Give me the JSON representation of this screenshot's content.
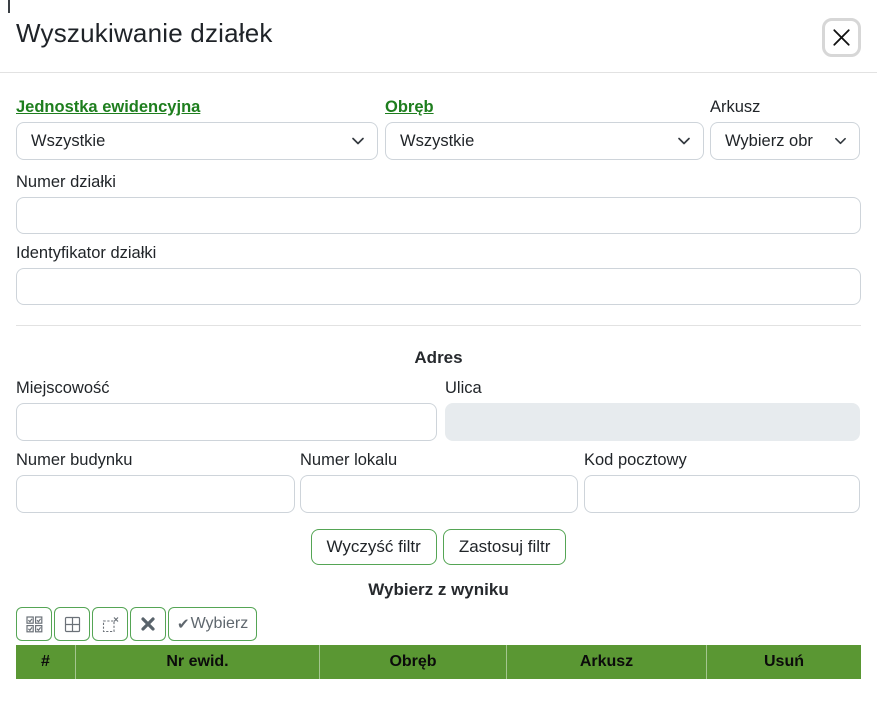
{
  "dialog": {
    "title": "Wyszukiwanie działek"
  },
  "icons": {
    "close": "x-icon",
    "chevron": "chevron-down-icon",
    "select_all": "grid-of-checked-boxes-icon",
    "grid": "window-grid-icon",
    "clear_selection": "dashed-box-remove-icon",
    "cancel": "bold-x-icon",
    "check_glyph": "✔"
  },
  "filters": {
    "jednostka": {
      "label": "Jednostka ewidencyjna",
      "value": "Wszystkie"
    },
    "obreb": {
      "label": "Obręb",
      "value": "Wszystkie"
    },
    "arkusz": {
      "label": "Arkusz",
      "value": "Wybierz obr"
    },
    "numer_dzialki": {
      "label": "Numer działki",
      "value": ""
    },
    "identyfikator_dzialki": {
      "label": "Identyfikator działki",
      "value": ""
    }
  },
  "address": {
    "heading": "Adres",
    "miejscowosc": {
      "label": "Miejscowość",
      "value": ""
    },
    "ulica": {
      "label": "Ulica",
      "value": ""
    },
    "numer_budynku": {
      "label": "Numer budynku",
      "value": ""
    },
    "numer_lokalu": {
      "label": "Numer lokalu",
      "value": ""
    },
    "kod_pocztowy": {
      "label": "Kod pocztowy",
      "value": ""
    }
  },
  "actions": {
    "clear_label": "Wyczyść filtr",
    "apply_label": "Zastosuj filtr"
  },
  "results": {
    "heading": "Wybierz z wyniku",
    "toolbar": {
      "wybierz_label": "Wybierz",
      "check_glyph": "✔"
    },
    "table": {
      "columns": [
        "#",
        "Nr ewid.",
        "Obręb",
        "Arkusz",
        "Usuń"
      ],
      "rows": []
    }
  },
  "colors": {
    "accent_green_link": "#1e7e1e",
    "table_header_green": "#5a9733",
    "button_border_green": "#55a555",
    "disabled_input_bg": "#e7ebee"
  }
}
